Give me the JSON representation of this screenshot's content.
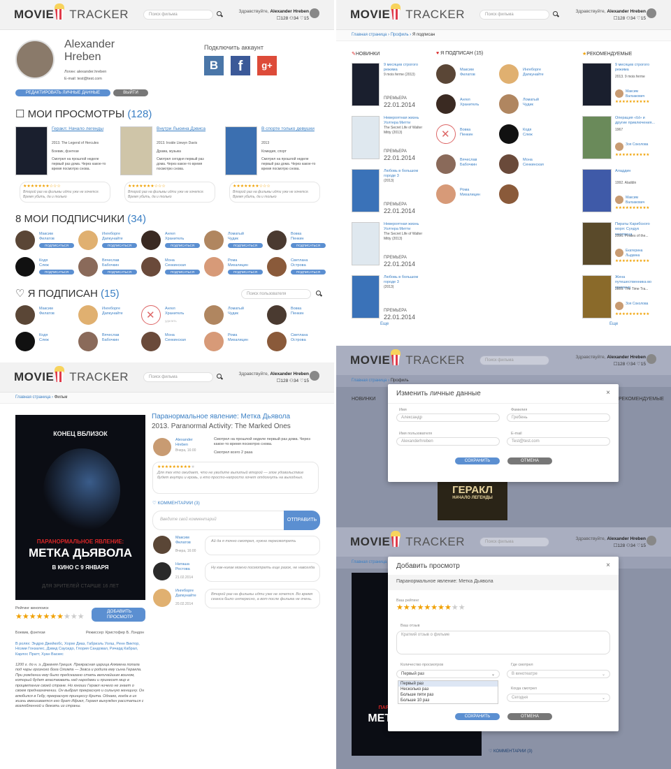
{
  "header": {
    "logo_left": "MOVIE",
    "logo_right": "TRACKER",
    "search_placeholder": "Поиск фильма",
    "greeting": "Здравствуйте,",
    "user_name": "Alexander Hreben",
    "stat_views": "128",
    "stat_followers": "34",
    "stat_following": "15"
  },
  "profile": {
    "name_first": "Alexander",
    "name_last": "Hreben",
    "login": "Логин: alexander.hreben",
    "email": "E-mail: test@test.com",
    "edit_button": "РЕДАКТИРОВАТЬ ЛИЧНЫЕ ДАННЫЕ",
    "logout_button": "ВЫЙТИ",
    "connect_title": "Подключить аккаунт",
    "social": [
      "В",
      "f",
      "g+"
    ]
  },
  "views_section": {
    "title": "МОИ ПРОСМОТРЫ",
    "count": "(128)",
    "items": [
      {
        "title": "Геракл: Начало легенды",
        "meta": "2013. The Legend of Hercules",
        "genre": "Боевик, фэнтези",
        "note": "Смотрел на прошлой неделе первый раз дома. Через какое-то время посмотрю снова.",
        "review": "Второй раз на фильмы идти уже не хочется. Время убить, да и только"
      },
      {
        "title": "Внутри Льюина Дэвиса",
        "meta": "2013. Inside Llewyn Davis",
        "genre": "Драма, музыка",
        "note": "Смотрел сегодня первый раз дома. Через какое-то время посмотрю снова.",
        "review": "Второй раз на фильмы идти уже не хочется. Время убить, да и только"
      },
      {
        "title": "В спорте только девушки",
        "meta": "2013",
        "genre": "Комедия, спорт",
        "note": "Смотрел на прошлой неделе первый раз дома. Через какое-то время посмотрю снова.",
        "review": "Второй раз на фильмы идти уже не хочется. Время убить, да и только"
      }
    ]
  },
  "followers_section": {
    "title": "МОИ ПОДПИСЧИКИ",
    "count": "(34)",
    "subscribe_label": "ПОДПИСАТЬСЯ",
    "people": [
      {
        "first": "Максим",
        "last": "Филатов"
      },
      {
        "first": "Ингеборге",
        "last": "Дапкунайте"
      },
      {
        "first": "Ангел",
        "last": "Хранитель"
      },
      {
        "first": "Ломатый",
        "last": "Чудик"
      },
      {
        "first": "Вовка",
        "last": "Пенкин"
      },
      {
        "first": "Кодя",
        "last": "Слеж"
      },
      {
        "first": "Вячеслав",
        "last": "Бабочкин"
      },
      {
        "first": "Мона",
        "last": "Сенкинская"
      },
      {
        "first": "Рома",
        "last": "Михалицин"
      },
      {
        "first": "Светлана",
        "last": "Островa"
      }
    ]
  },
  "following_section": {
    "title": "Я ПОДПИСАН",
    "count": "(15)",
    "search_placeholder": "Поиск пользователя",
    "unsubscribed_note": "удалить"
  },
  "breadcrumb": {
    "home": "Главная страница",
    "profile": "Профиль",
    "current": "Я подписан",
    "film": "Фильм"
  },
  "feed": {
    "col_new": "НОВИНКИ",
    "col_following": "Я ПОДПИСАН (15)",
    "col_recommended": "РЕКОМЕНДУЕМЫЕ",
    "premiere_label": "ПРЕМЬЕРА",
    "premiere_date": "22.01.2014",
    "new_items": [
      {
        "title": "9 месяцев строгого режима",
        "meta": "9 mois ferme (2013)"
      },
      {
        "title": "Невероятная жизнь Уолтера Митти",
        "meta": "The Secret Life of Walter Mitty (2013)"
      },
      {
        "title": "Любовь в большом городе 3",
        "meta": "(2013)"
      },
      {
        "title": "Невероятная жизнь Уолтера Митти",
        "meta": "The Secret Life of Walter Mitty (2013)"
      },
      {
        "title": "Любовь в большом городе 3",
        "meta": "(2013)"
      }
    ],
    "rec_items": [
      {
        "title": "9 месяцев строгого режима",
        "meta": "2013. 9 mois ferme",
        "user": "Максим Валзакович"
      },
      {
        "title": "Операция «Ы» и другие приключения...",
        "meta": "1967",
        "user": "Зоя Соколова"
      },
      {
        "title": "Аладдин",
        "meta": "1992. Aladdin",
        "user": "Максим Валзакович"
      },
      {
        "title": "Пираты Карибского моря: Сундук мертвеца",
        "meta": "2006. Pirates of the...",
        "user": "Екатерина Лыдкина"
      },
      {
        "title": "Жена путешественника во времени",
        "meta": "2009. The Time Tra...",
        "user": "Зоя Соколова"
      }
    ],
    "more": "Еще"
  },
  "film": {
    "title": "Паранормальное явление: Метка Дьявола",
    "subtitle": "2013. Paranormal Activity: The Marked Ones",
    "poster_top": "КОНЕЦ ВБЛИЗОК",
    "poster_line1": "ПАРАНОРМАЛЬНОЕ ЯВЛЕНИЕ:",
    "poster_line2": "МЕТКА ДЬЯВОЛА",
    "poster_date": "В КИНО С 9 ЯНВАРЯ",
    "poster_age": "ДЛЯ ЗРИТЕЛЕЙ СТАРШЕ 16 ЛЕТ",
    "rating_label": "Рейтинг кинопоиск",
    "add_button": "ДОБАВИТЬ ПРОСМОТР",
    "genre": "Боевик, фэнтези",
    "director": "Режиссер: Кристофер Б. Лэндон",
    "cast": "В ролях: Эндрю Джейкобс, Хорхе Диаз, Габриэль Уолш, Ренн Виктор, Ноэми Гонзалес, Дэвид Саусидо, Глория Сандовал, Ричард Кабрал, Карлос Пратт, Хуан Васкес",
    "synopsis": "1200 г. до н. э. Древняя Греция. Прекрасная царица Алкмена попала под чары грозного бога Олимпа — Зевса и родила ему сына Геракла. При рождении ему было предсказано стать величайшим воином, который будет властвовать над народами и принесет мир в процветание своей стране. Но юноши Геракл ничего не знает о своем предназначении. Он выбрал прекрасную и сильную женщину. Он влюбился в Гебу, прекрасную принцессу Крита. Однако, когда в их жизнь вмешивается его брат Ификл, Геракл вынужден расстаться с возлюбленной и бежать из страны.",
    "reviewer_name": "Alexander Hreben",
    "reviewer_date": "Вчера, 16:00",
    "review_note": "Смотрел на прошлой неделе первый раз дома. Через какое-то время посмотрю снова.",
    "review_count": "Смотрел всего 2 раза",
    "review_text": "Для тех кто ожидает, что не увидите вылитый второй — злое удовольствие будет внутри и кровь, и кто просто-напросто хочет отдохнуть на выходных.",
    "comments_label": "КОММЕНТАРИИ (3)",
    "comment_placeholder": "Введите свой комментарий",
    "send_button": "ОТПРАВИТЬ",
    "comments": [
      {
        "name": "Максим Филатов",
        "date": "Вчера, 16:00",
        "text": "Ай да я точно смотрел, нужно пересмотреть"
      },
      {
        "name": "Наташа Ростова",
        "date": "21.02.2014",
        "text": "Ну как-никак можно посмотреть еще разок, не навсегда"
      },
      {
        "name": "Ингеборге Дапкунайте",
        "date": "20.02.2014",
        "text": "Второй раз на фильмы идти уже не хочется. Во время сеанса было интересно, а вот после фильма не очень."
      }
    ]
  },
  "edit_modal": {
    "title": "Изменить личные данные",
    "close": "×",
    "name_label": "Имя",
    "name_value": "Александр",
    "surname_label": "Фамилия",
    "surname_value": "Гребень",
    "username_label": "Имя пользователя",
    "username_value": "Alexanderhreben",
    "email_label": "E-mail",
    "email_value": "Test@test.com",
    "save": "СОХРАНИТЬ",
    "cancel": "ОТМЕНА"
  },
  "add_modal": {
    "title": "Добавить просмотр",
    "close": "×",
    "film": "Паранормальное явление: Метка Дьявола",
    "rating_label": "Ваш рейтинг",
    "review_label": "Ваш отзыв",
    "review_placeholder": "Краткий отзыв о фильме",
    "count_label": "Количество просмотров",
    "count_value": "Первый раз",
    "count_options": [
      "Первый раз",
      "Несколько раз",
      "Больше пяти раз",
      "Больше 10 раз"
    ],
    "where_label": "Где смотрел",
    "where_value": "В кинотеатре",
    "when_label": "Когда смотрел",
    "when_value": "Сегодня",
    "save": "СОХРАНИТЬ",
    "cancel": "ОТМЕНА"
  },
  "colors": {
    "accent": "#3a7fc4",
    "button_blue": "#5b8fd1",
    "button_gray": "#777777",
    "star": "#f0a000",
    "poster_red": "#d92626"
  }
}
